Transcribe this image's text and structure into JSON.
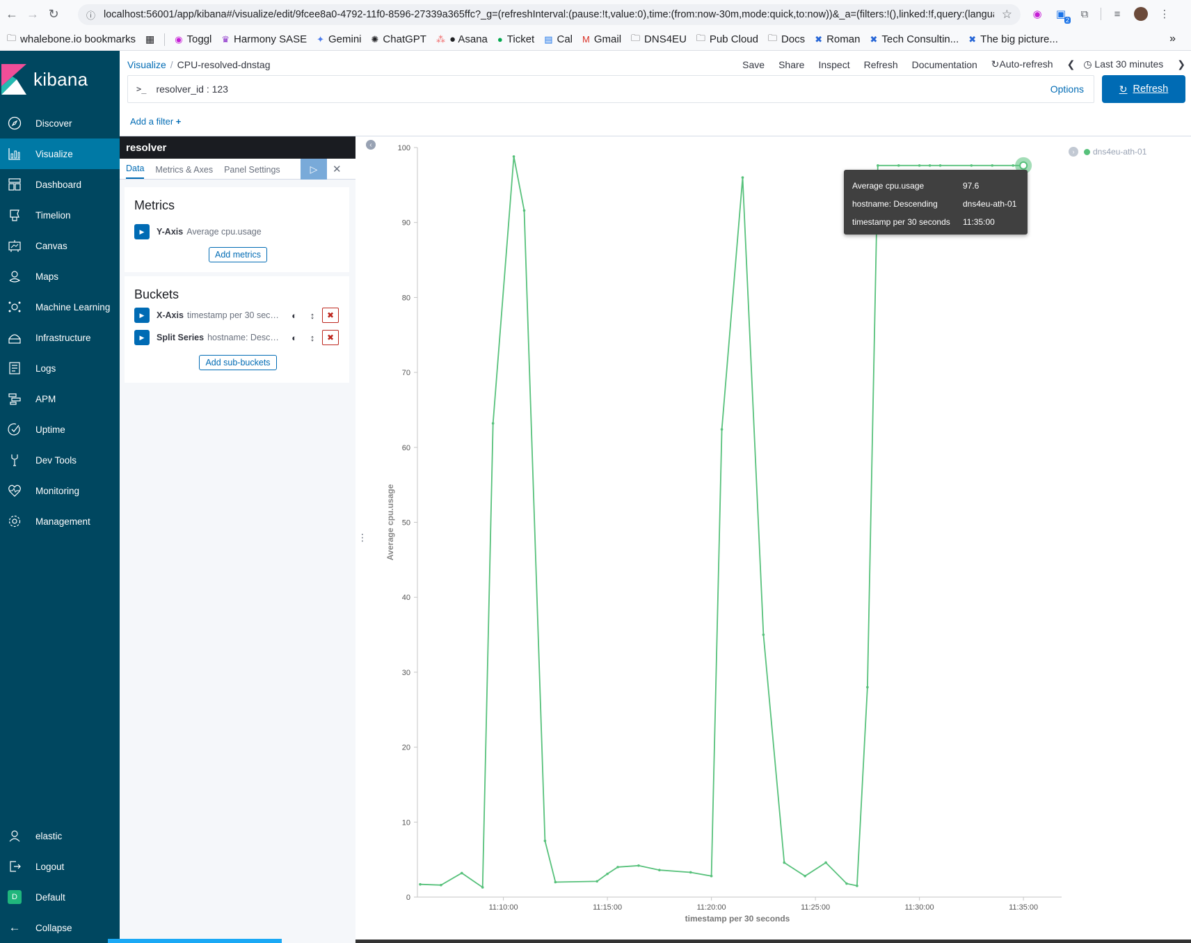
{
  "browser": {
    "url": "localhost:56001/app/kibana#/visualize/edit/9fcee8a0-4792-11f0-8596-27339a365ffc?_g=(refreshInterval:(pause:!t,value:0),time:(from:now-30m,mode:quick,to:now))&_a=(filters:!(),linked:!f,query:(langua...",
    "bookmarks": [
      {
        "label": "whalebone.io bookmarks",
        "icon": "folder-person-icon"
      },
      {
        "label": "Toggl",
        "icon": "toggl-icon"
      },
      {
        "label": "Harmony SASE",
        "icon": "harmony-icon"
      },
      {
        "label": "Gemini",
        "icon": "gemini-icon"
      },
      {
        "label": "ChatGPT",
        "icon": "chatgpt-icon"
      },
      {
        "label": "● Asana",
        "icon": "asana-icon"
      },
      {
        "label": "Ticket",
        "icon": "ticket-icon"
      },
      {
        "label": "Cal",
        "icon": "calendar-icon"
      },
      {
        "label": "Gmail",
        "icon": "gmail-icon"
      },
      {
        "label": "DNS4EU",
        "icon": "folder-icon"
      },
      {
        "label": "Pub Cloud",
        "icon": "folder-icon"
      },
      {
        "label": "Docs",
        "icon": "folder-icon"
      },
      {
        "label": "Roman",
        "icon": "confluence-icon"
      },
      {
        "label": "Tech Consultin...",
        "icon": "confluence-icon"
      },
      {
        "label": "The big picture...",
        "icon": "confluence-icon"
      }
    ],
    "extension_badge": "2"
  },
  "sidebar": {
    "logo": "kibana",
    "items": [
      {
        "label": "Discover",
        "icon": "compass-icon"
      },
      {
        "label": "Visualize",
        "icon": "visualize-icon"
      },
      {
        "label": "Dashboard",
        "icon": "dashboard-icon"
      },
      {
        "label": "Timelion",
        "icon": "timelion-icon"
      },
      {
        "label": "Canvas",
        "icon": "canvas-icon"
      },
      {
        "label": "Maps",
        "icon": "maps-icon"
      },
      {
        "label": "Machine Learning",
        "icon": "ml-icon"
      },
      {
        "label": "Infrastructure",
        "icon": "infrastructure-icon"
      },
      {
        "label": "Logs",
        "icon": "logs-icon"
      },
      {
        "label": "APM",
        "icon": "apm-icon"
      },
      {
        "label": "Uptime",
        "icon": "uptime-icon"
      },
      {
        "label": "Dev Tools",
        "icon": "devtools-icon"
      },
      {
        "label": "Monitoring",
        "icon": "monitoring-icon"
      },
      {
        "label": "Management",
        "icon": "gear-icon"
      }
    ],
    "bottom": {
      "user": "elastic",
      "logout": "Logout",
      "space": "Default",
      "space_initial": "D",
      "collapse": "Collapse"
    }
  },
  "header": {
    "breadcrumb_root": "Visualize",
    "breadcrumb_current": "CPU-resolved-dnstag",
    "menu": {
      "save": "Save",
      "share": "Share",
      "inspect": "Inspect",
      "refresh": "Refresh",
      "documentation": "Documentation",
      "auto_refresh": "Auto-refresh",
      "time_range": "Last 30 minutes"
    }
  },
  "query": {
    "prompt": ">_",
    "text": "resolver_id : 123",
    "options": "Options",
    "refresh_button": "Refresh"
  },
  "filters": {
    "add_filter": "Add a filter"
  },
  "editor": {
    "title": "resolver",
    "tabs": [
      "Data",
      "Metrics & Axes",
      "Panel Settings"
    ],
    "metrics_title": "Metrics",
    "metrics": [
      {
        "label": "Y-Axis",
        "desc": "Average cpu.usage"
      }
    ],
    "add_metrics": "Add metrics",
    "buckets_title": "Buckets",
    "buckets": [
      {
        "label": "X-Axis",
        "desc": "timestamp per 30 seconds"
      },
      {
        "label": "Split Series",
        "desc": "hostname: Descending"
      }
    ],
    "add_sub_buckets": "Add sub-buckets"
  },
  "tooltip": {
    "rows": [
      {
        "key": "Average cpu.usage",
        "value": "97.6"
      },
      {
        "key": "hostname: Descending",
        "value": "dns4eu-ath-01"
      },
      {
        "key": "timestamp per 30 seconds",
        "value": "11:35:00"
      }
    ]
  },
  "chart_data": {
    "type": "line",
    "title": "",
    "xlabel": "timestamp per 30 seconds",
    "ylabel": "Average cpu.usage",
    "ylim": [
      0,
      100
    ],
    "yticks": [
      0,
      10,
      20,
      30,
      40,
      50,
      60,
      70,
      80,
      90,
      100
    ],
    "xlim": [
      "11:06:00",
      "11:36:30"
    ],
    "xticks": [
      "11:10:00",
      "11:15:00",
      "11:20:00",
      "11:25:00",
      "11:30:00",
      "11:35:00"
    ],
    "legend_position": "top-right",
    "color": "#57c17b",
    "series": [
      {
        "name": "dns4eu-ath-01",
        "x": [
          "11:06:00",
          "11:07:00",
          "11:08:00",
          "11:09:00",
          "11:09:30",
          "11:10:30",
          "11:11:00",
          "11:12:00",
          "11:12:30",
          "11:14:30",
          "11:15:00",
          "11:15:30",
          "11:16:30",
          "11:17:30",
          "11:19:00",
          "11:20:00",
          "11:20:30",
          "11:21:30",
          "11:22:30",
          "11:23:30",
          "11:24:30",
          "11:25:30",
          "11:26:30",
          "11:27:00",
          "11:27:30",
          "11:28:00",
          "11:29:00",
          "11:30:00",
          "11:30:30",
          "11:31:00",
          "11:32:30",
          "11:33:30",
          "11:34:30",
          "11:35:00"
        ],
        "values": [
          1.7,
          1.6,
          3.2,
          1.3,
          63.2,
          98.8,
          91.6,
          7.5,
          2.0,
          2.1,
          3.1,
          4.0,
          4.2,
          3.6,
          3.3,
          2.8,
          62.4,
          96.0,
          35.0,
          4.6,
          2.8,
          4.6,
          1.8,
          1.5,
          28.0,
          97.6,
          97.6,
          97.6,
          97.6,
          97.6,
          97.6,
          97.6,
          97.6,
          97.6
        ],
        "highlight": {
          "x": "11:35:00",
          "y": 97.6
        }
      }
    ]
  }
}
